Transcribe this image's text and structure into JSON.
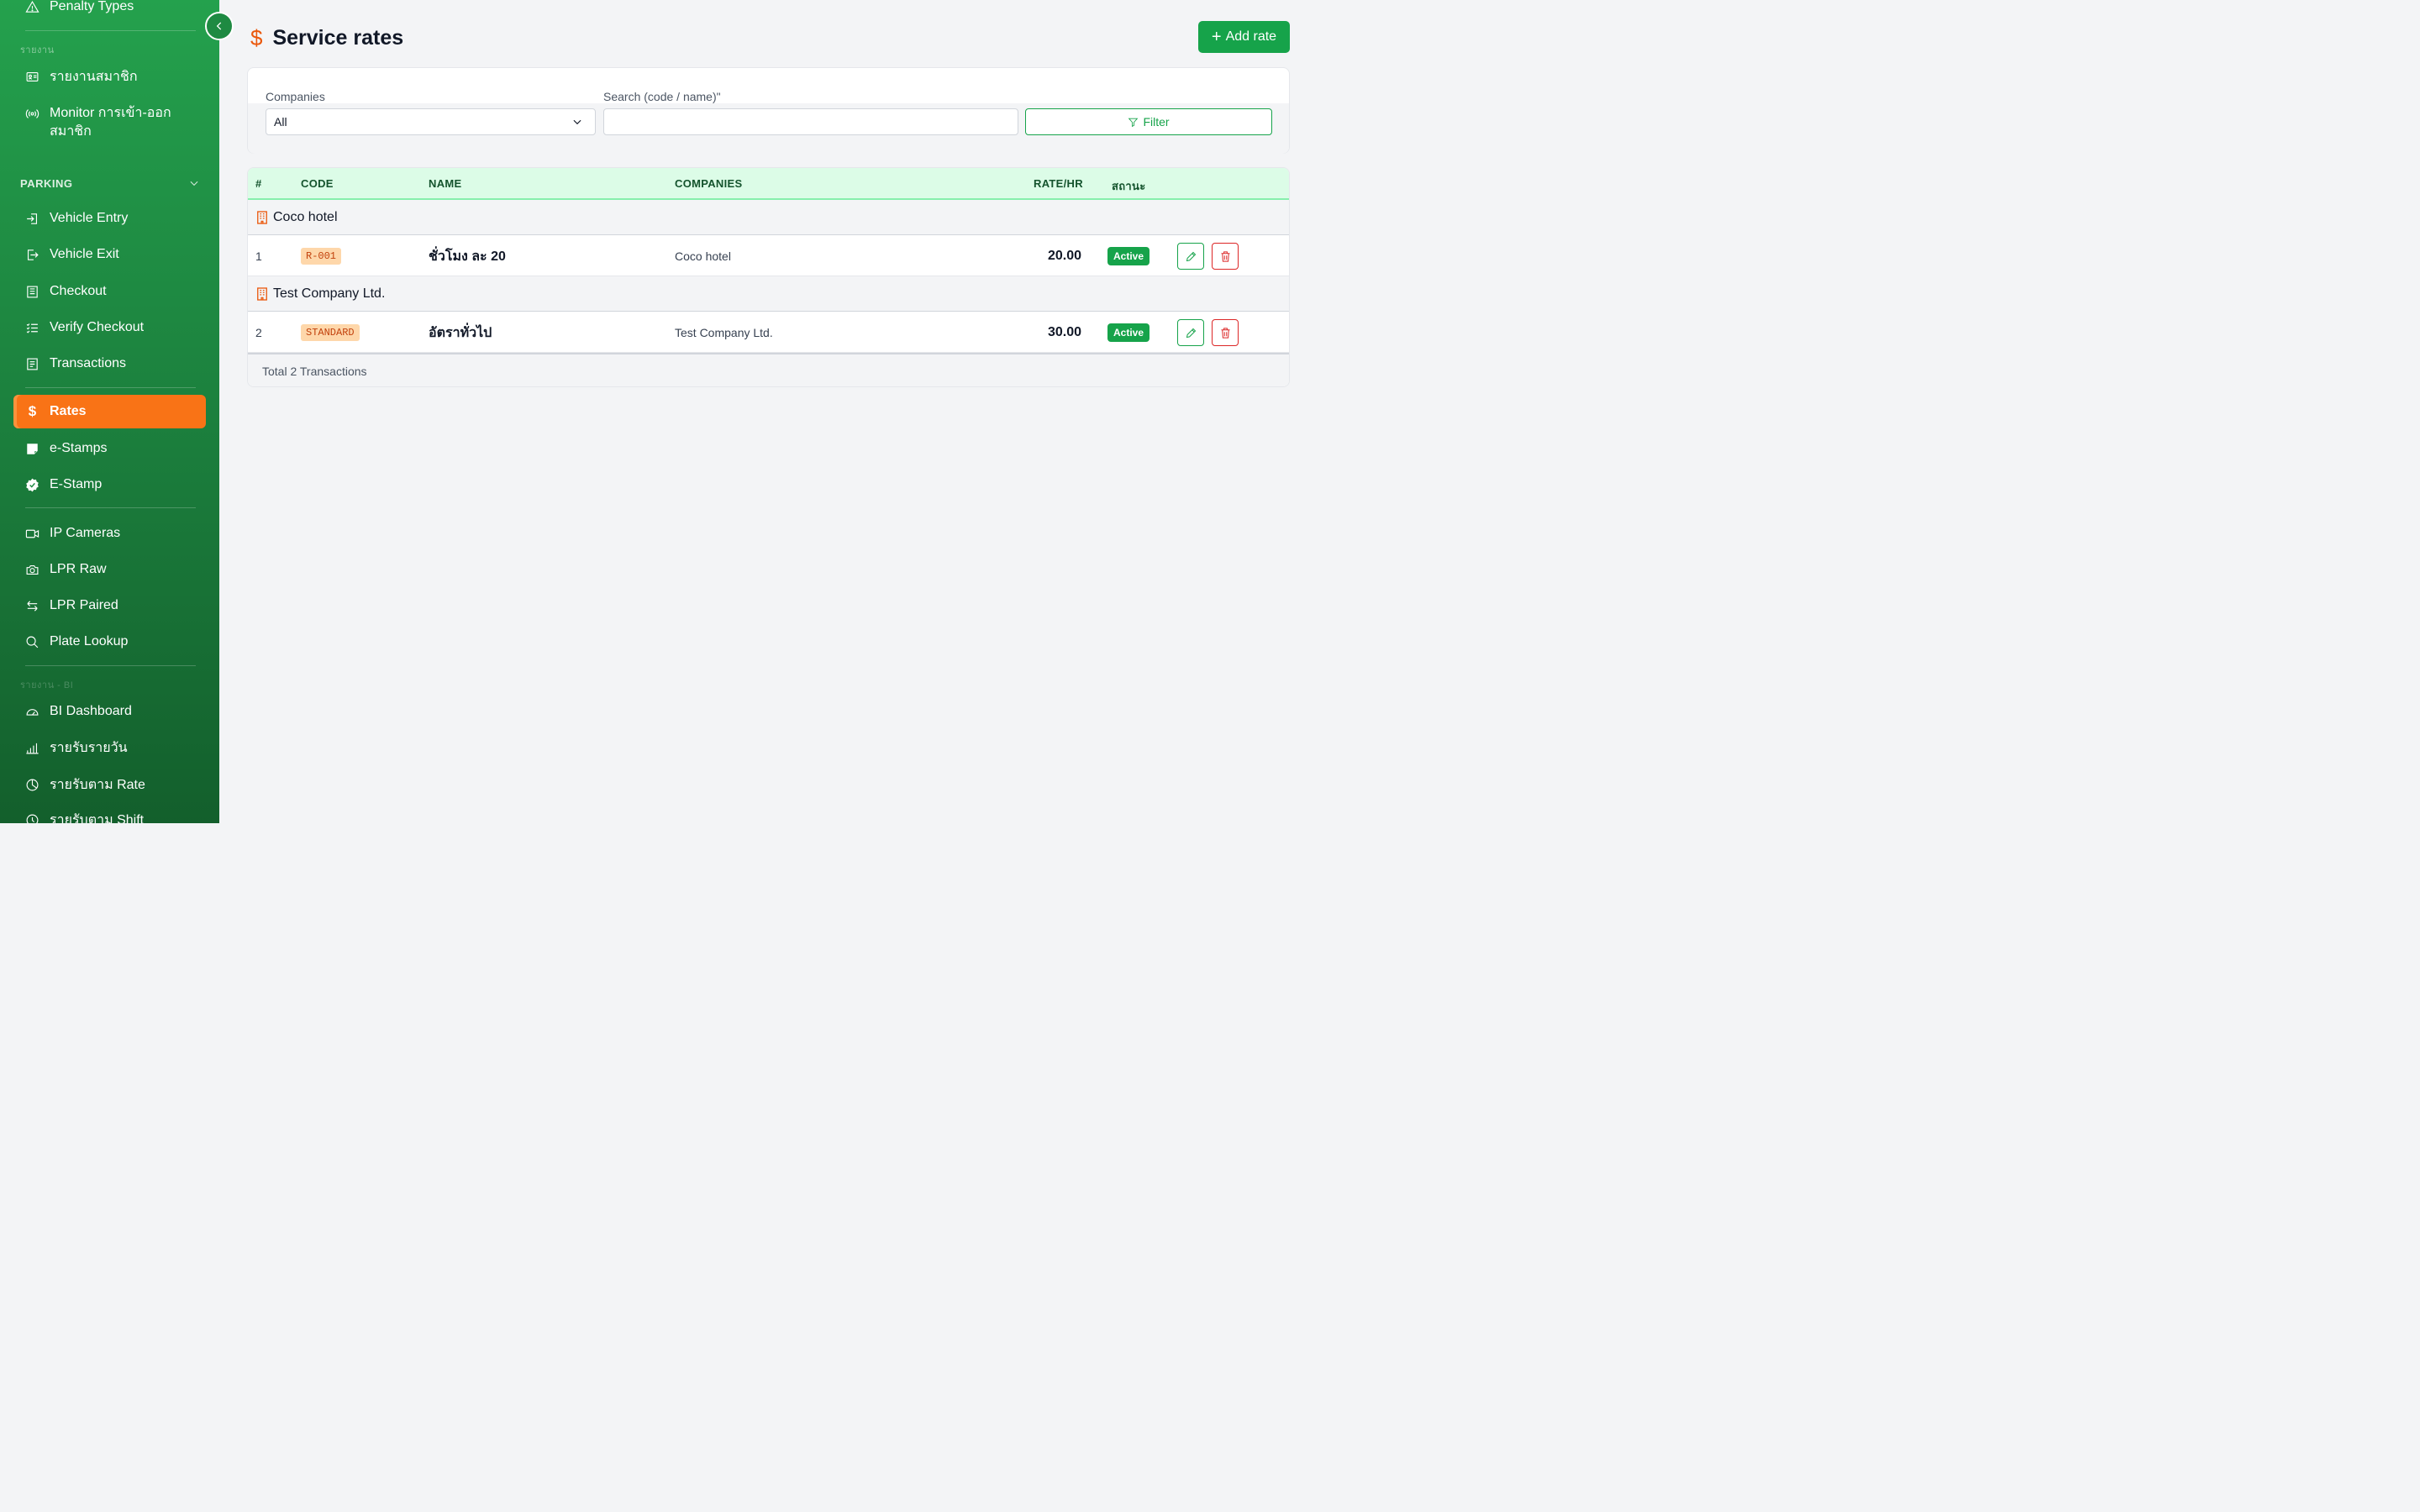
{
  "page": {
    "title": "Service rates",
    "add_label": "Add rate"
  },
  "sidebar": {
    "items": [
      {
        "label": "Penalty Types",
        "icon": "warning-triangle-icon"
      },
      {
        "label": "รายงานสมาชิก",
        "icon": "id-card-icon"
      },
      {
        "label": "Monitor การเข้า-ออก สมาชิก",
        "icon": "broadcast-icon"
      },
      {
        "label": "Vehicle Entry",
        "icon": "sign-in-icon"
      },
      {
        "label": "Vehicle Exit",
        "icon": "sign-out-icon"
      },
      {
        "label": "Checkout",
        "icon": "receipt-icon"
      },
      {
        "label": "Verify Checkout",
        "icon": "checklist-icon"
      },
      {
        "label": "Transactions",
        "icon": "ledger-icon"
      },
      {
        "label": "Rates",
        "icon": "dollar-icon"
      },
      {
        "label": "e-Stamps",
        "icon": "sticky-note-icon"
      },
      {
        "label": "E-Stamp",
        "icon": "verified-badge-icon"
      },
      {
        "label": "IP Cameras",
        "icon": "video-camera-icon"
      },
      {
        "label": "LPR Raw",
        "icon": "camera-icon"
      },
      {
        "label": "LPR Paired",
        "icon": "arrows-swap-icon"
      },
      {
        "label": "Plate Lookup",
        "icon": "search-icon"
      },
      {
        "label": "BI Dashboard",
        "icon": "speedometer-icon"
      },
      {
        "label": "รายรับรายวัน",
        "icon": "bar-chart-icon"
      },
      {
        "label": "รายรับตาม Rate",
        "icon": "pie-chart-icon"
      },
      {
        "label": "รายรับตาม Shift",
        "icon": "clock-icon"
      }
    ],
    "caption_reports": "รายงาน",
    "section_parking": "PARKING",
    "caption_bottom": "รายงาน - BI"
  },
  "filter": {
    "companies_label": "Companies",
    "companies_value": "All",
    "search_label": "Search (code / name)\"",
    "search_value": "",
    "filter_label": "Filter"
  },
  "table": {
    "headers": {
      "num": "#",
      "code": "CODE",
      "name": "NAME",
      "companies": "COMPANIES",
      "rate": "RATE/HR",
      "status": "สถานะ"
    },
    "groups": [
      {
        "name": "Coco hotel",
        "rows": [
          {
            "num": "1",
            "code": "R-001",
            "name": "ชั่วโมง ละ 20",
            "company": "Coco hotel",
            "rate": "20.00",
            "status": "Active"
          }
        ]
      },
      {
        "name": "Test Company Ltd.",
        "rows": [
          {
            "num": "2",
            "code": "STANDARD",
            "name": "อัตราทั่วไป",
            "company": "Test Company Ltd.",
            "rate": "30.00",
            "status": "Active"
          }
        ]
      }
    ],
    "footer": "Total 2 Transactions"
  },
  "colors": {
    "sidebar_green": "#1e8a42",
    "accent_orange": "#f97316",
    "primary_green": "#16a34a",
    "header_green": "#dcfce7"
  }
}
